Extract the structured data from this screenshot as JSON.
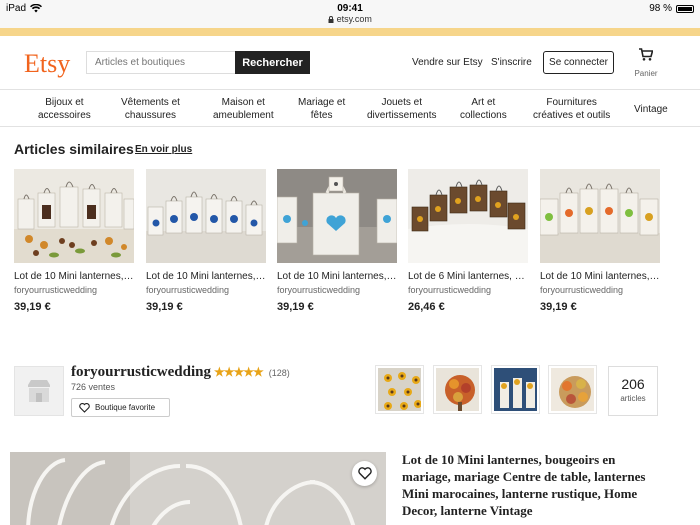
{
  "status_bar": {
    "device": "iPad",
    "time": "09:41",
    "url": "etsy.com",
    "battery": "98 %",
    "wifi_icon": "wifi-icon",
    "lock_icon": "lock-icon"
  },
  "header": {
    "logo": "Etsy",
    "search_placeholder": "Articles et boutiques",
    "search_button": "Rechercher",
    "sell_link": "Vendre sur Etsy",
    "register_link": "S'inscrire",
    "login_button": "Se connecter",
    "cart_label": "Panier",
    "cart_icon": "cart-icon"
  },
  "categories": [
    {
      "label": "Bijoux et\naccessoires"
    },
    {
      "label": "Vêtements et\nchaussures"
    },
    {
      "label": "Maison et\nameublement"
    },
    {
      "label": "Mariage et\nfêtes"
    },
    {
      "label": "Jouets et\ndivertissements"
    },
    {
      "label": "Art et\ncollections"
    },
    {
      "label": "Fournitures\ncréatives et outils"
    },
    {
      "label": "Vintage"
    }
  ],
  "similar": {
    "title": "Articles similaires",
    "see_more": "En voir plus",
    "items": [
      {
        "title": "Lot de 10 Mini lanternes, ...",
        "shop": "foryourrusticwedding",
        "price": "39,19 €"
      },
      {
        "title": "Lot de 10 Mini lanternes, ...",
        "shop": "foryourrusticwedding",
        "price": "39,19 €"
      },
      {
        "title": "Lot de 10 Mini lanternes, ...",
        "shop": "foryourrusticwedding",
        "price": "39,19 €"
      },
      {
        "title": "Lot de 6 Mini lanternes, b...",
        "shop": "foryourrusticwedding",
        "price": "26,46 €"
      },
      {
        "title": "Lot de 10 Mini lanternes, ...",
        "shop": "foryourrusticwedding",
        "price": "39,19 €"
      }
    ]
  },
  "shop": {
    "name": "foryourrusticwedding",
    "rating": 4.5,
    "stars": "★★★★★",
    "reviews": "(128)",
    "sales": "726 ventes",
    "favorite_button": "Boutique favorite",
    "item_count": "206",
    "item_count_label": "articles"
  },
  "listing": {
    "title": "Lot de 10 Mini lanternes, bougeoirs en mariage, mariage Centre de table, lanternes Mini marocaines, lanterne rustique, Home Decor, lanterne Vintage"
  },
  "colors": {
    "brand": "#f1641e",
    "search_button": "#222222",
    "star": "#e8a317",
    "banner": "#f6d58a"
  }
}
